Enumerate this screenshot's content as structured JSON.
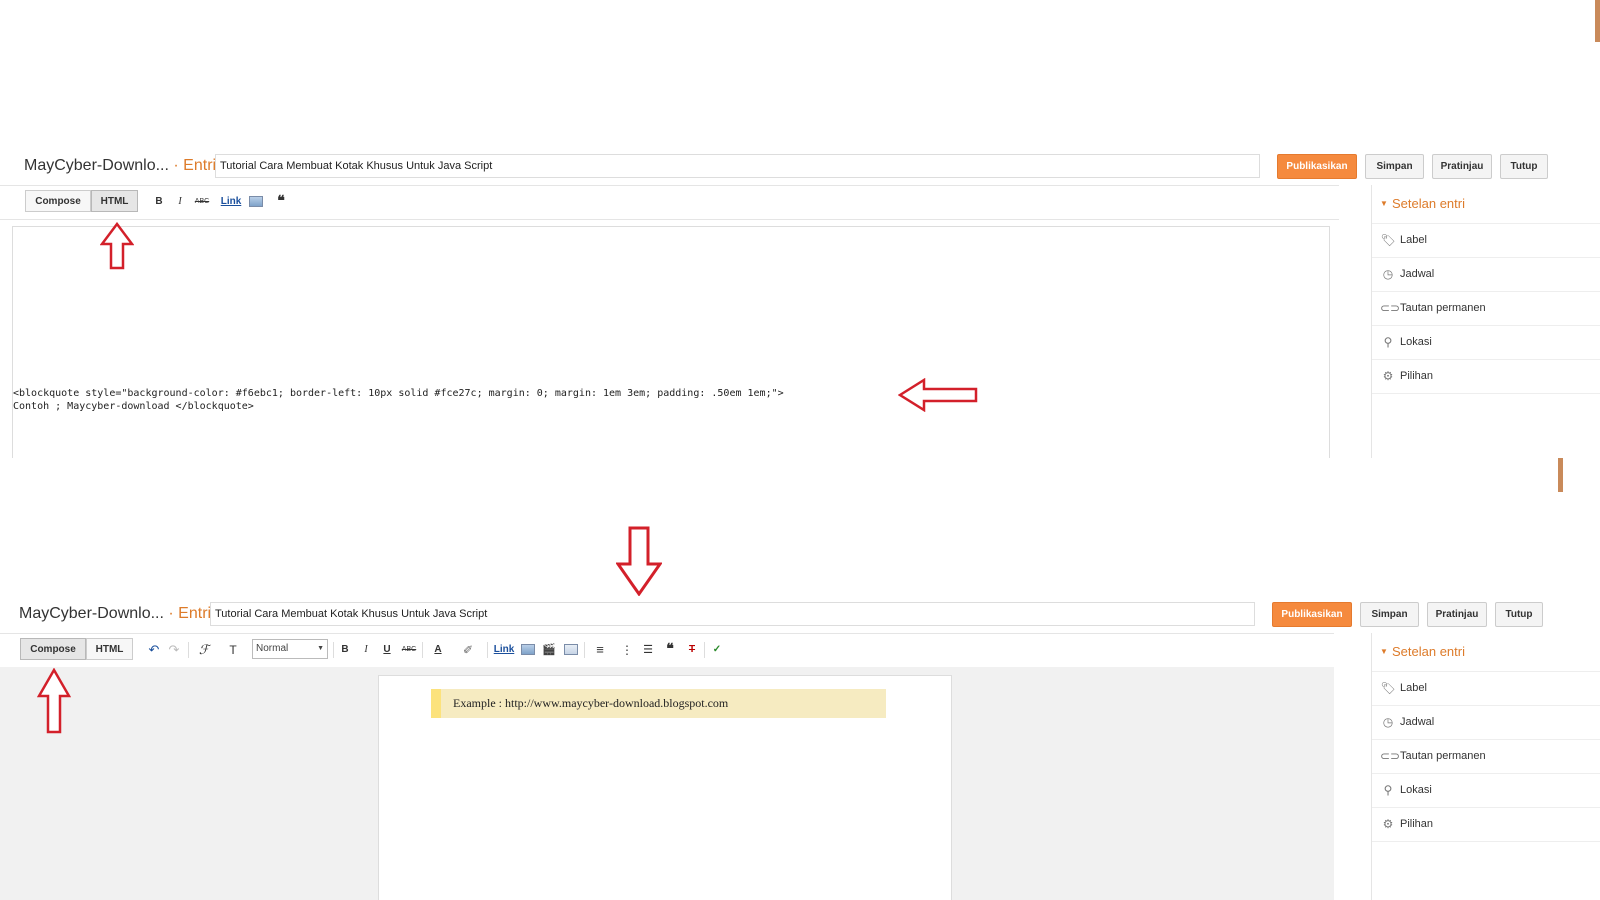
{
  "editor": {
    "blog_name": "MayCyber-Downlo...",
    "separator": "·",
    "section": "Entri",
    "post_title": "Tutorial Cara Membuat Kotak Khusus Untuk Java Script"
  },
  "actions": {
    "publish": "Publikasikan",
    "save": "Simpan",
    "preview": "Pratinjau",
    "close": "Tutup"
  },
  "modes": {
    "compose": "Compose",
    "html": "HTML"
  },
  "toolbar": {
    "bold": "B",
    "italic": "I",
    "underline": "U",
    "strike": "ABC",
    "link": "Link",
    "quote": "❝",
    "font_size_value": "Normal",
    "undo": "↶",
    "redo": "↷",
    "font_family": "ℱ",
    "font_size": "T",
    "text_color": "A",
    "highlight": "✐",
    "align": "≡",
    "numbered_list": "⋮",
    "bulleted_list": "☰",
    "clear_format": "T",
    "spellcheck": "✓"
  },
  "sidebar": {
    "heading": "Setelan entri",
    "items": [
      {
        "label": "Label",
        "icon": "tag-icon"
      },
      {
        "label": "Jadwal",
        "icon": "clock-icon"
      },
      {
        "label": "Tautan permanen",
        "icon": "link-icon"
      },
      {
        "label": "Lokasi",
        "icon": "location-pin-icon"
      },
      {
        "label": "Pilihan",
        "icon": "gear-icon"
      }
    ]
  },
  "html_view": {
    "code_line1": "<blockquote style=\"background-color: #f6ebc1; border-left: 10px solid #fce27c; margin: 0; margin: 1em 3em; padding: .50em 1em;\">",
    "code_line2": "Contoh ; Maycyber-download </blockquote>"
  },
  "compose_view": {
    "blockquote_text": "Example : http://www.maycyber-download.blogspot.com"
  },
  "colors": {
    "accent_orange": "#dd7b2a",
    "publish_button": "#f58a3e",
    "blockquote_bg": "#f6ebc1",
    "blockquote_border": "#fce27c",
    "annotation_arrow": "#d3202a"
  }
}
